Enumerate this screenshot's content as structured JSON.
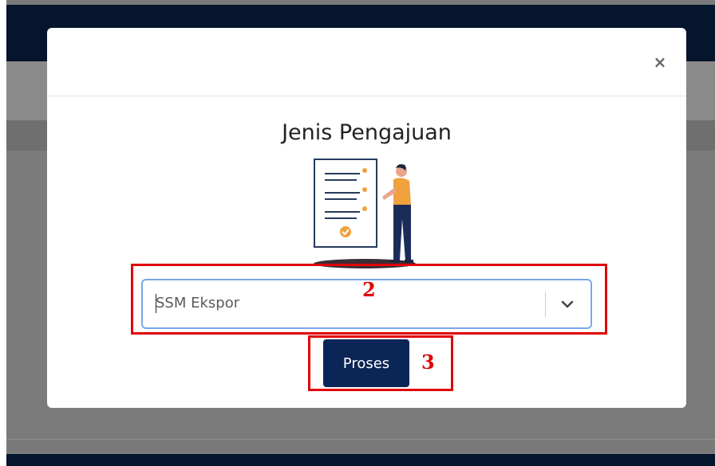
{
  "modal": {
    "close_symbol": "×",
    "title": "Jenis Pengajuan",
    "select": {
      "value": "SSM Ekspor"
    },
    "proses_label": "Proses"
  },
  "annotations": [
    {
      "label": "2"
    },
    {
      "label": "3"
    }
  ],
  "colors": {
    "topbar": "#04152d",
    "primary_button": "#0b2556",
    "select_border": "#7aa7e8",
    "annotation": "#e00000",
    "illustration_accent": "#f0a03c"
  },
  "icons": {
    "close": "close-icon",
    "chevron": "chevron-down-icon",
    "illustration": "document-person-illustration"
  }
}
